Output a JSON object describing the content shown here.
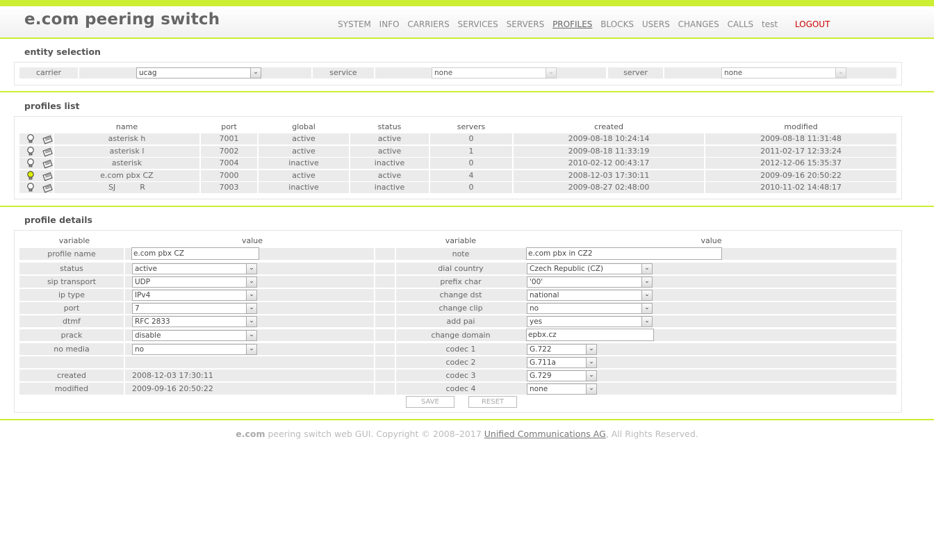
{
  "app": {
    "title": "e.com peering switch"
  },
  "nav": [
    {
      "label": "SYSTEM"
    },
    {
      "label": "INFO"
    },
    {
      "label": "CARRIERS"
    },
    {
      "label": "SERVICES"
    },
    {
      "label": "SERVERS"
    },
    {
      "label": "PROFILES",
      "active": true
    },
    {
      "label": "BLOCKS"
    },
    {
      "label": "USERS"
    },
    {
      "label": "CHANGES"
    },
    {
      "label": "CALLS"
    },
    {
      "label": "test"
    }
  ],
  "logout_label": "LOGOUT",
  "entity": {
    "title": "entity selection",
    "carrier_label": "carrier",
    "carrier_value": "ucag",
    "service_label": "service",
    "service_value": "none",
    "server_label": "server",
    "server_value": "none"
  },
  "profiles": {
    "title": "profiles list",
    "headers": [
      "name",
      "port",
      "global",
      "status",
      "servers",
      "created",
      "modified"
    ],
    "rows": [
      [
        "asterisk h",
        "7001",
        "active",
        "active",
        "0",
        "2009-08-18 10:24:14",
        "2009-08-18 11:31:48"
      ],
      [
        "asterisk l",
        "7002",
        "active",
        "active",
        "1",
        "2009-08-18 11:33:19",
        "2011-02-17 12:33:24"
      ],
      [
        "asterisk",
        "7004",
        "inactive",
        "inactive",
        "0",
        "2010-02-12 00:43:17",
        "2012-12-06 15:35:37"
      ],
      [
        "e.com pbx CZ",
        "7000",
        "active",
        "active",
        "4",
        "2008-12-03 17:30:11",
        "2009-09-16 20:50:22"
      ],
      [
        "SJ          R",
        "7003",
        "inactive",
        "inactive",
        "0",
        "2009-08-27 02:48:00",
        "2010-11-02 14:48:17"
      ]
    ],
    "selected_row": 3
  },
  "details": {
    "title": "profile details",
    "col_variable": "variable",
    "col_value": "value",
    "left": [
      {
        "label": "profile name",
        "value": "e.com pbx CZ",
        "kind": "input"
      },
      {
        "label": "status",
        "value": "active",
        "kind": "select"
      },
      {
        "label": "sip transport",
        "value": "UDP",
        "kind": "select"
      },
      {
        "label": "ip type",
        "value": "IPv4",
        "kind": "select"
      },
      {
        "label": "port",
        "value": "7",
        "kind": "select"
      },
      {
        "label": "dtmf",
        "value": "RFC 2833",
        "kind": "select"
      },
      {
        "label": "prack",
        "value": "disable",
        "kind": "select"
      },
      {
        "label": "no media",
        "value": "no",
        "kind": "select"
      },
      {
        "label": "",
        "value": "",
        "kind": "empty"
      },
      {
        "label": "created",
        "value": "2008-12-03 17:30:11",
        "kind": "text"
      },
      {
        "label": "modified",
        "value": "2009-09-16 20:50:22",
        "kind": "text"
      }
    ],
    "right": [
      {
        "label": "note",
        "value": "e.com pbx in CZ2",
        "kind": "input"
      },
      {
        "label": "dial country",
        "value": "Czech Republic (CZ)",
        "kind": "select"
      },
      {
        "label": "prefix char",
        "value": "'00'",
        "kind": "select"
      },
      {
        "label": "change dst",
        "value": "national",
        "kind": "select"
      },
      {
        "label": "change clip",
        "value": "no",
        "kind": "select"
      },
      {
        "label": "add pai",
        "value": "yes",
        "kind": "select"
      },
      {
        "label": "change domain",
        "value": "epbx.cz",
        "kind": "input"
      },
      {
        "label": "codec 1",
        "value": "G.722",
        "kind": "select"
      },
      {
        "label": "codec 2",
        "value": "G.711a",
        "kind": "select"
      },
      {
        "label": "codec 3",
        "value": "G.729",
        "kind": "select"
      },
      {
        "label": "codec 4",
        "value": "none",
        "kind": "select"
      }
    ],
    "save_label": "SAVE",
    "reset_label": "RESET"
  },
  "footer": {
    "brand": "e.com",
    "text": " peering switch web GUI. Copyright © 2008–2017 ",
    "link": "Unified Communications AG",
    "suffix": ", All Rights Reserved."
  },
  "colors": {
    "accent": "#ccee33",
    "logout": "#cc0000",
    "row_bg": "#ebebeb",
    "bulb_on": "#ddee00"
  }
}
